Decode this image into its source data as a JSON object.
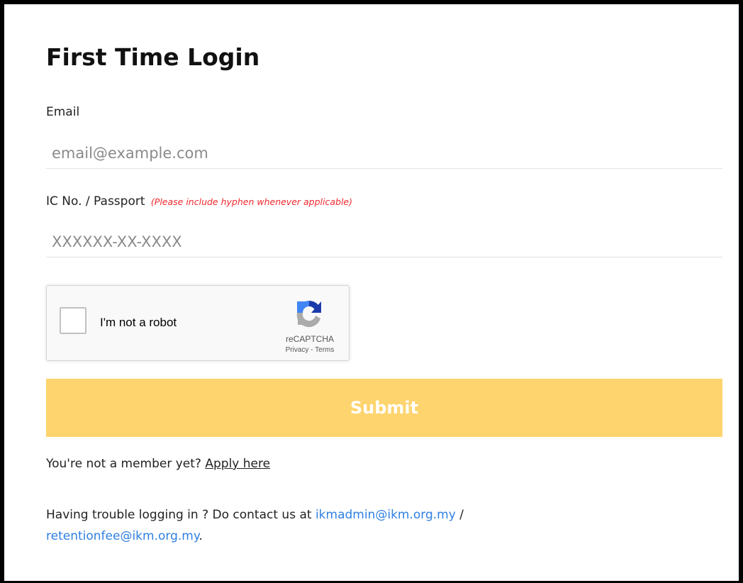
{
  "form": {
    "title": "First Time Login",
    "email_label": "Email",
    "email_placeholder": "email@example.com",
    "ic_label": "IC No. / Passport",
    "ic_hint": "(Please include hyphen whenever applicable)",
    "ic_placeholder": "XXXXXX-XX-XXXX",
    "submit_label": "Submit"
  },
  "captcha": {
    "label": "I'm not a robot",
    "brand": "reCAPTCHA",
    "privacy": "Privacy",
    "separator": " - ",
    "terms": "Terms",
    "checked": false
  },
  "footer": {
    "member_text": "You're not a member yet? ",
    "apply_link": "Apply here",
    "trouble_text": "Having trouble logging in ? Do contact us at ",
    "email1": "ikmadmin@ikm.org.my",
    "sep": " / ",
    "email2": "retentionfee@ikm.org.my",
    "end": "."
  },
  "colors": {
    "submit_bg": "#fed46e",
    "link": "#2f7fe0",
    "hint": "#f0282d"
  }
}
